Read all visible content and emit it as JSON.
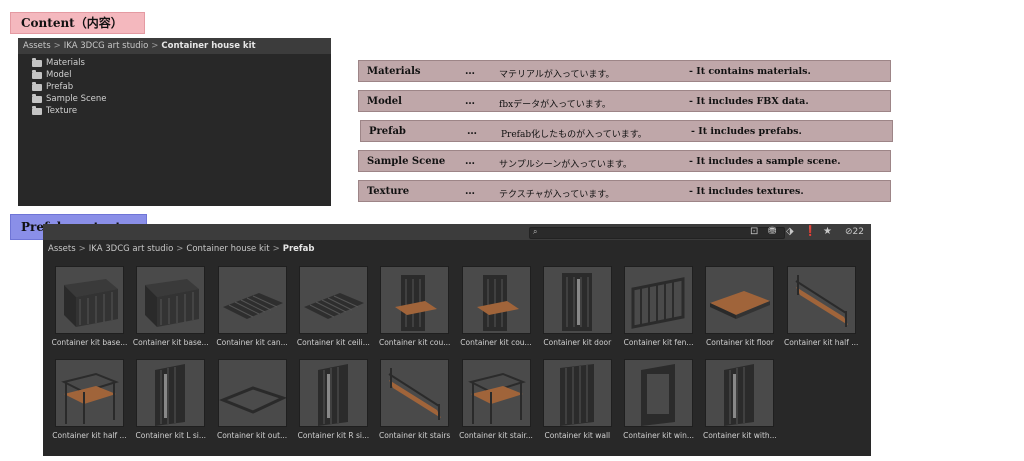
{
  "banners": {
    "content": "Content（内容）",
    "prefab": "Prefab contents"
  },
  "top_panel": {
    "breadcrumb": [
      "Assets",
      "IKA 3DCG art studio",
      "Container house kit"
    ],
    "folders": [
      "Materials",
      "Model",
      "Prefab",
      "Sample Scene",
      "Texture"
    ]
  },
  "descriptions": [
    {
      "name": "Materials",
      "dots": "…",
      "jp": "マテリアルが入っています。",
      "en": "- It contains materials."
    },
    {
      "name": "Model",
      "dots": "…",
      "jp": "fbxデータが入っています。",
      "en": "- It includes FBX data."
    },
    {
      "name": "Prefab",
      "dots": "…",
      "jp": "Prefab化したものが入っています。",
      "en": "- It includes prefabs."
    },
    {
      "name": "Sample Scene",
      "dots": "…",
      "jp": "サンプルシーンが入っています。",
      "en": "- It includes a sample scene."
    },
    {
      "name": "Texture",
      "dots": "…",
      "jp": "テクスチャが入っています。",
      "en": "- It includes textures."
    }
  ],
  "prefab_panel": {
    "breadcrumb": [
      "Assets",
      "IKA 3DCG art studio",
      "Container house kit",
      "Prefab"
    ],
    "hidden_count": "22",
    "colors": {
      "panel": "#282828",
      "header": "#3c3c3c",
      "thumb": "#4a4a4a",
      "wood": "#a0643a"
    },
    "items": [
      {
        "label": "Container kit base...",
        "icon": "container-box-icon"
      },
      {
        "label": "Container kit base...",
        "icon": "container-box-icon"
      },
      {
        "label": "Container kit can...",
        "icon": "flat-panel-icon"
      },
      {
        "label": "Container kit ceili...",
        "icon": "flat-panel-icon"
      },
      {
        "label": "Container kit cou...",
        "icon": "counter-icon"
      },
      {
        "label": "Container kit cou...",
        "icon": "counter-icon"
      },
      {
        "label": "Container kit door",
        "icon": "door-icon"
      },
      {
        "label": "Container kit fen...",
        "icon": "fence-icon"
      },
      {
        "label": "Container kit floor",
        "icon": "floor-icon"
      },
      {
        "label": "Container kit half ...",
        "icon": "stairs-icon"
      },
      {
        "label": "Container kit half ...",
        "icon": "deck-icon"
      },
      {
        "label": "Container kit L si...",
        "icon": "side-wall-icon"
      },
      {
        "label": "Container kit out...",
        "icon": "out-floor-icon"
      },
      {
        "label": "Container kit R si...",
        "icon": "side-wall-icon"
      },
      {
        "label": "Container kit stairs",
        "icon": "stairs-icon"
      },
      {
        "label": "Container kit stair...",
        "icon": "deck-icon"
      },
      {
        "label": "Container kit wall",
        "icon": "wall-icon"
      },
      {
        "label": "Container kit win...",
        "icon": "window-icon"
      },
      {
        "label": "Container kit with...",
        "icon": "side-wall-icon"
      }
    ]
  }
}
